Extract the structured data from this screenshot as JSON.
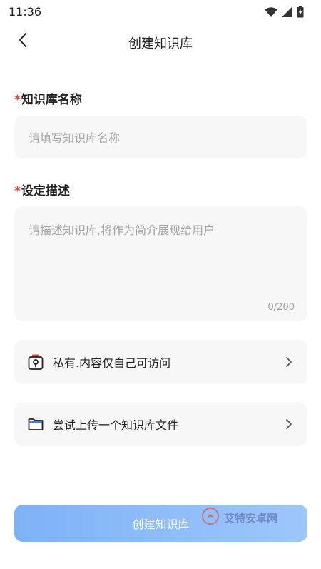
{
  "status_bar": {
    "time": "11:36"
  },
  "header": {
    "title": "创建知识库"
  },
  "form": {
    "name": {
      "required_mark": "*",
      "label": "知识库名称",
      "placeholder": "请填写知识库名称"
    },
    "description": {
      "required_mark": "*",
      "label": "设定描述",
      "placeholder": "请描述知识库,将作为简介展现给用户",
      "counter": "0/200"
    }
  },
  "options": {
    "privacy": {
      "icon": "lock-icon",
      "label": "私有.内容仅自己可访问"
    },
    "upload": {
      "icon": "folder-icon",
      "label": "尝试上传一个知识库文件"
    }
  },
  "footer": {
    "create_label": "创建知识库",
    "watermark": "艾特安卓网"
  },
  "colors": {
    "required": "#e2453d",
    "button_start": "#7eb2f7",
    "button_end": "#9dc7fb",
    "field_bg": "#f7f7f8"
  }
}
